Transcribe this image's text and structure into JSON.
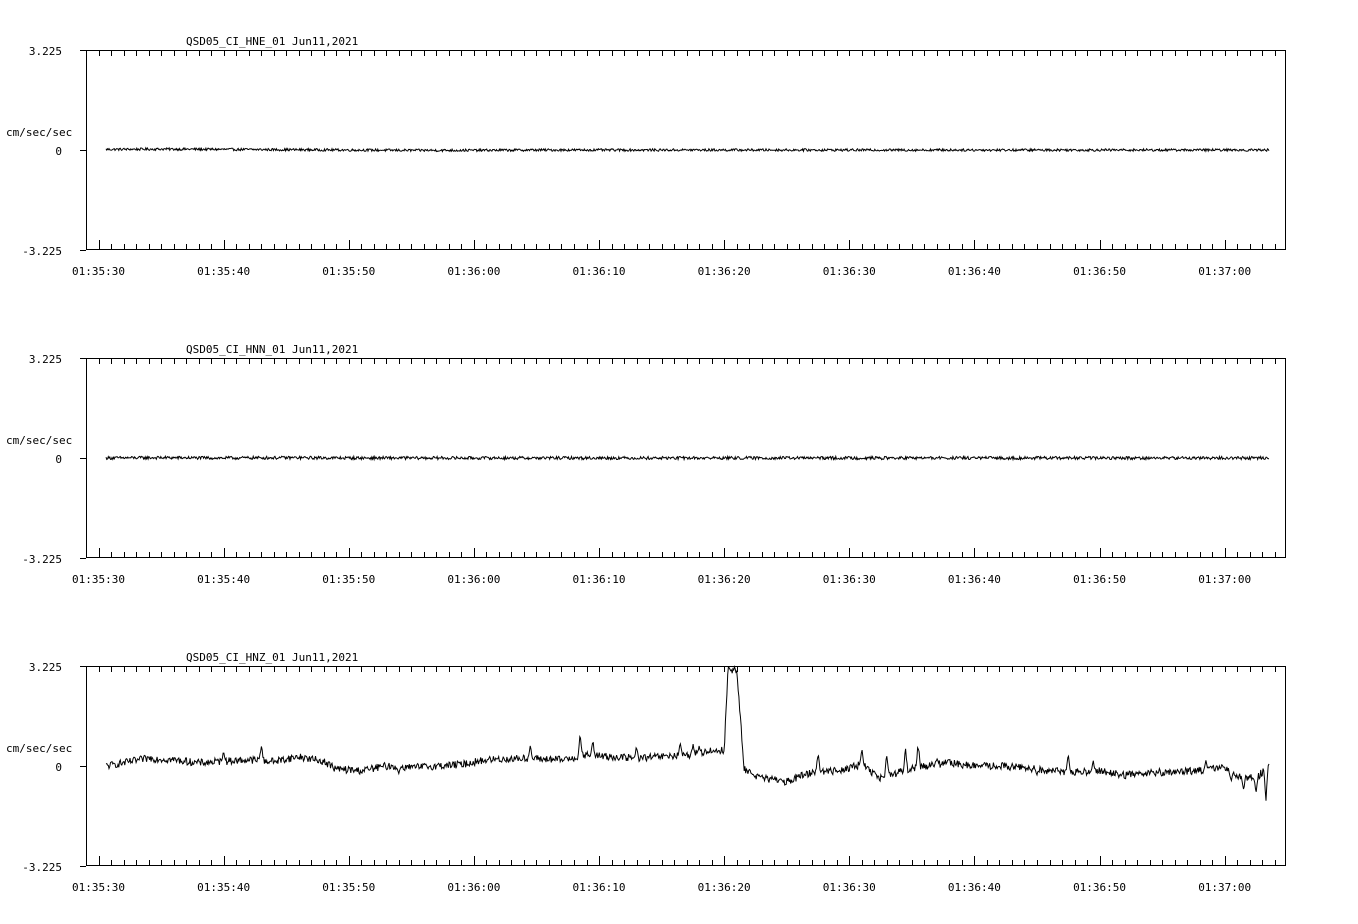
{
  "chart_data": [
    {
      "type": "line",
      "title": "QSD05_CI_HNE_01  Jun11,2021",
      "ylabel": "cm/sec/sec",
      "ylim": [
        -3.225,
        3.225
      ],
      "y_tick_labels": [
        "3.225",
        "0",
        "-3.225"
      ],
      "x_tick_labels": [
        "01:35:30",
        "01:35:40",
        "01:35:50",
        "01:36:00",
        "01:36:10",
        "01:36:20",
        "01:36:30",
        "01:36:40",
        "01:36:50",
        "01:37:00"
      ],
      "x_range_seconds_from_first_label": [
        -1.0,
        94.9
      ],
      "trace_span_seconds_from_first_label": [
        0.6,
        93.6
      ],
      "samples": [
        [
          0.6,
          0.02
        ],
        [
          5,
          0.03
        ],
        [
          10,
          0.02
        ],
        [
          15,
          0.01
        ],
        [
          20,
          0.0
        ],
        [
          25,
          -0.01
        ],
        [
          30,
          -0.01
        ],
        [
          35,
          0.0
        ],
        [
          40,
          0.0
        ],
        [
          45,
          0.0
        ],
        [
          50,
          0.0
        ],
        [
          55,
          0.0
        ],
        [
          60,
          0.0
        ],
        [
          65,
          0.0
        ],
        [
          70,
          0.0
        ],
        [
          75,
          0.0
        ],
        [
          80,
          0.0
        ],
        [
          85,
          0.0
        ],
        [
          90,
          0.0
        ],
        [
          93.6,
          0.0
        ]
      ],
      "noise_amplitude": 0.04
    },
    {
      "type": "line",
      "title": "QSD05_CI_HNN_01  Jun11,2021",
      "ylabel": "cm/sec/sec",
      "ylim": [
        -3.225,
        3.225
      ],
      "y_tick_labels": [
        "3.225",
        "0",
        "-3.225"
      ],
      "x_tick_labels": [
        "01:35:30",
        "01:35:40",
        "01:35:50",
        "01:36:00",
        "01:36:10",
        "01:36:20",
        "01:36:30",
        "01:36:40",
        "01:36:50",
        "01:37:00"
      ],
      "x_range_seconds_from_first_label": [
        -1.0,
        94.9
      ],
      "trace_span_seconds_from_first_label": [
        0.6,
        93.6
      ],
      "samples": [
        [
          0.6,
          0.0
        ],
        [
          5,
          0.01
        ],
        [
          10,
          0.0
        ],
        [
          15,
          0.01
        ],
        [
          20,
          0.0
        ],
        [
          25,
          0.0
        ],
        [
          30,
          0.0
        ],
        [
          35,
          0.0
        ],
        [
          40,
          0.0
        ],
        [
          45,
          0.0
        ],
        [
          50,
          0.0
        ],
        [
          55,
          0.0
        ],
        [
          60,
          0.0
        ],
        [
          65,
          0.0
        ],
        [
          70,
          0.0
        ],
        [
          75,
          0.0
        ],
        [
          80,
          0.0
        ],
        [
          85,
          0.0
        ],
        [
          90,
          0.0
        ],
        [
          93.6,
          0.0
        ]
      ],
      "noise_amplitude": 0.05
    },
    {
      "type": "line",
      "title": "QSD05_CI_HNZ_01  Jun11,2021",
      "ylabel": "cm/sec/sec",
      "ylim": [
        -3.225,
        3.225
      ],
      "y_tick_labels": [
        "3.225",
        "0",
        "-3.225"
      ],
      "x_tick_labels": [
        "01:35:30",
        "01:35:40",
        "01:35:50",
        "01:36:00",
        "01:36:10",
        "01:36:20",
        "01:36:30",
        "01:36:40",
        "01:36:50",
        "01:37:00"
      ],
      "x_range_seconds_from_first_label": [
        -1.0,
        94.9
      ],
      "trace_span_seconds_from_first_label": [
        0.6,
        93.6
      ],
      "samples": [
        [
          0.6,
          0.0
        ],
        [
          2,
          0.1
        ],
        [
          4,
          0.25
        ],
        [
          6,
          0.2
        ],
        [
          8,
          0.1
        ],
        [
          10,
          0.15
        ],
        [
          12,
          0.2
        ],
        [
          14,
          0.15
        ],
        [
          16,
          0.3
        ],
        [
          18,
          0.15
        ],
        [
          19,
          -0.1
        ],
        [
          21,
          -0.15
        ],
        [
          23,
          0.0
        ],
        [
          25,
          -0.05
        ],
        [
          27,
          0.0
        ],
        [
          29,
          0.05
        ],
        [
          31,
          0.2
        ],
        [
          34,
          0.25
        ],
        [
          37,
          0.2
        ],
        [
          39,
          0.35
        ],
        [
          41,
          0.3
        ],
        [
          43,
          0.25
        ],
        [
          45,
          0.3
        ],
        [
          47,
          0.35
        ],
        [
          49,
          0.5
        ],
        [
          50.0,
          0.5
        ],
        [
          50.3,
          3.1
        ],
        [
          51.0,
          3.1
        ],
        [
          51.3,
          1.5
        ],
        [
          51.6,
          -0.1
        ],
        [
          53,
          -0.4
        ],
        [
          55,
          -0.5
        ],
        [
          57,
          -0.2
        ],
        [
          59,
          -0.15
        ],
        [
          61,
          0.05
        ],
        [
          62.5,
          -0.4
        ],
        [
          64,
          -0.2
        ],
        [
          66,
          0.0
        ],
        [
          68,
          0.1
        ],
        [
          70,
          0.0
        ],
        [
          72,
          0.0
        ],
        [
          74,
          -0.05
        ],
        [
          76,
          -0.15
        ],
        [
          78,
          -0.2
        ],
        [
          80,
          -0.15
        ],
        [
          82,
          -0.3
        ],
        [
          84,
          -0.2
        ],
        [
          86,
          -0.2
        ],
        [
          88,
          -0.15
        ],
        [
          90,
          -0.05
        ],
        [
          91,
          -0.3
        ],
        [
          92.5,
          -0.4
        ],
        [
          93.6,
          0.05
        ]
      ],
      "spikes": [
        [
          10,
          0.5
        ],
        [
          13,
          0.8
        ],
        [
          24,
          -0.3
        ],
        [
          34.5,
          0.7
        ],
        [
          38.5,
          1.2
        ],
        [
          39.5,
          0.9
        ],
        [
          43,
          0.7
        ],
        [
          46.5,
          0.8
        ],
        [
          47.5,
          0.75
        ],
        [
          48,
          0.65
        ],
        [
          54.5,
          -0.4
        ],
        [
          57.5,
          0.6
        ],
        [
          61,
          0.65
        ],
        [
          63,
          0.5
        ],
        [
          64.5,
          0.7
        ],
        [
          65.5,
          0.9
        ],
        [
          67,
          0.3
        ],
        [
          75,
          -0.3
        ],
        [
          77.5,
          0.45
        ],
        [
          79.5,
          0.2
        ],
        [
          88.5,
          0.2
        ],
        [
          90.5,
          -0.6
        ],
        [
          91.5,
          -0.9
        ],
        [
          92.5,
          -0.9
        ],
        [
          93.3,
          -1.2
        ]
      ],
      "noise_amplitude": 0.12
    }
  ]
}
